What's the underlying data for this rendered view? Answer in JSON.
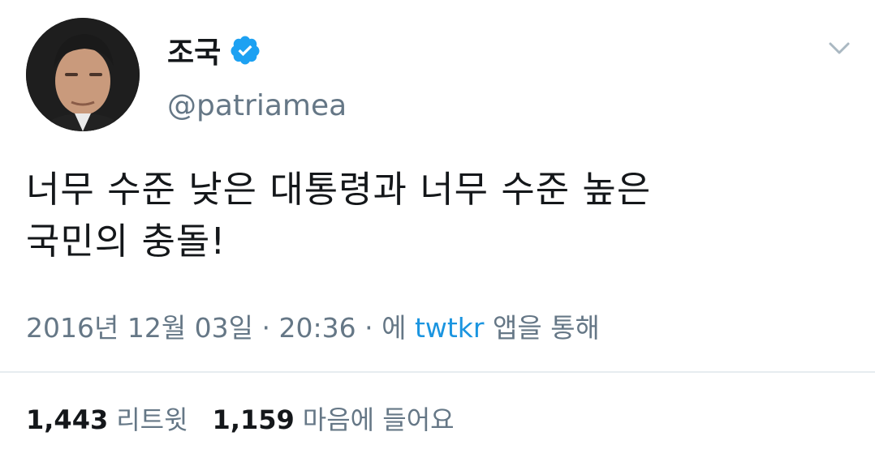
{
  "author": {
    "name": "조국",
    "handle": "@patriamea",
    "verified": true,
    "avatar_icon": "profile-photo"
  },
  "tweet": {
    "text_line1": "너무 수준 낮은 대통령과 너무 수준 높은",
    "text_line2": "국민의 충돌!"
  },
  "meta": {
    "timestamp": "2016년 12월 03일 · 20:36 · 에",
    "app_name": "twtkr",
    "app_suffix": "앱을 통해"
  },
  "stats": {
    "retweets_count": "1,443",
    "retweets_label": "리트윗",
    "likes_count": "1,159",
    "likes_label": "마음에 들어요"
  },
  "colors": {
    "verified_blue": "#1da1f2",
    "link_blue": "#1b95e0",
    "secondary_text": "#657786"
  }
}
